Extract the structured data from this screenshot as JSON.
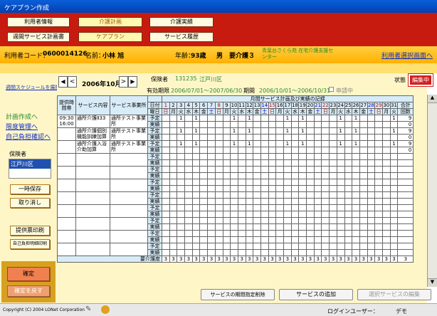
{
  "window": {
    "title": "ケアプラン作成"
  },
  "nav": {
    "row1": [
      "利用者情報",
      "介護計画",
      "介護実績"
    ],
    "row2": [
      "週間サービス計画書",
      "ケアプラン",
      "サービス履歴"
    ]
  },
  "user": {
    "code_label": "利用者コード：",
    "code": "0600014126",
    "name_label": "名前：",
    "name": "小林 旭",
    "age_label": "年齢：",
    "age": "93歳",
    "gender": "男",
    "care_level": "要介護３",
    "provider": "青葉台さくら苑 在宅介護支援センター",
    "select_screen_link": "利用者選択画面へ"
  },
  "period": {
    "insurer_label": "保険者",
    "insurer_code": "131235",
    "insurer_name": "江戸川区",
    "valid_label": "有効期限",
    "valid_range": "2006/07/01～2007/06/30",
    "period_label": "期間",
    "period_range": "2006/10/01～2006/10/31",
    "apply_label": "申請中",
    "status_label": "状態",
    "status_value": "編集中"
  },
  "month_nav": {
    "prev_year": "◀",
    "prev_month": "<",
    "month": "2006年10月",
    "next_month": ">",
    "next_year": "▶"
  },
  "left": {
    "weekly_link": "週間スケジュールを展開",
    "plan_link": "計画作成へ",
    "limit_link": "限度管理へ",
    "self_pay_link": "自己負担確認へ",
    "insurer_label": "保険者",
    "insurer_selected": "江戸川区",
    "btn_temp_save": "一時保存",
    "btn_cancel": "取り消し",
    "btn_print_ticket": "提供票印刷",
    "btn_print_detail": "自己負担明細印刷",
    "btn_confirm": "確定",
    "btn_revert": "確定を戻す"
  },
  "table": {
    "header_time": "提供時間帯",
    "header_content": "サービス内容",
    "header_provider": "サービス事業所",
    "header_date": "日付",
    "header_weekday": "曜日",
    "header_title": "月間サービス計画及び実績の記録",
    "header_total": "合計",
    "header_count": "回数",
    "planned": "予定",
    "actual": "実績",
    "care_level_label": "要介護度",
    "care_level_value": "3",
    "days": [
      "1",
      "2",
      "3",
      "4",
      "5",
      "6",
      "7",
      "8",
      "9",
      "10",
      "11",
      "12",
      "13",
      "14",
      "15",
      "16",
      "17",
      "18",
      "19",
      "20",
      "21",
      "22",
      "23",
      "24",
      "25",
      "26",
      "27",
      "28",
      "29",
      "30",
      "31"
    ],
    "weekdays": [
      "日",
      "月",
      "火",
      "水",
      "木",
      "金",
      "土",
      "日",
      "月",
      "火",
      "水",
      "木",
      "金",
      "土",
      "日",
      "月",
      "火",
      "水",
      "木",
      "金",
      "土",
      "日",
      "月",
      "火",
      "水",
      "木",
      "金",
      "土",
      "日",
      "月",
      "火"
    ],
    "services": [
      {
        "time": "09:30\n16:00",
        "content": "通所介護Ⅱ33",
        "provider": "通所テスト事業所",
        "plan_days": [
          3,
          5,
          10,
          12,
          17,
          19,
          24,
          26,
          31
        ],
        "plan_total": "9",
        "actual_total": "0"
      },
      {
        "time": "",
        "content": "通所介護個別機能訓練加算",
        "provider": "通所テスト事業所",
        "plan_days": [
          3,
          5,
          10,
          12,
          17,
          19,
          24,
          26,
          31
        ],
        "plan_total": "9",
        "actual_total": "0"
      },
      {
        "time": "",
        "content": "通所介護入浴介助加算",
        "provider": "通所テスト事業所",
        "plan_days": [
          3,
          5,
          10,
          12,
          17,
          19,
          24,
          26,
          31
        ],
        "plan_total": "9",
        "actual_total": "0"
      }
    ]
  },
  "bottom": {
    "btn_period_delete": "サービスの期間指定削除",
    "btn_add": "サービスの追加",
    "btn_edit": "選択サービスの編集"
  },
  "footer": {
    "copyright": "Copyright (C) 2004 LONet Corporation",
    "login_label": "ログインユーザー：",
    "login_user": "デモ"
  },
  "colors": {
    "title": "#0a5fd8",
    "red": "#c81b10",
    "orange": "#ffb000",
    "panel": "#fff6c8"
  }
}
